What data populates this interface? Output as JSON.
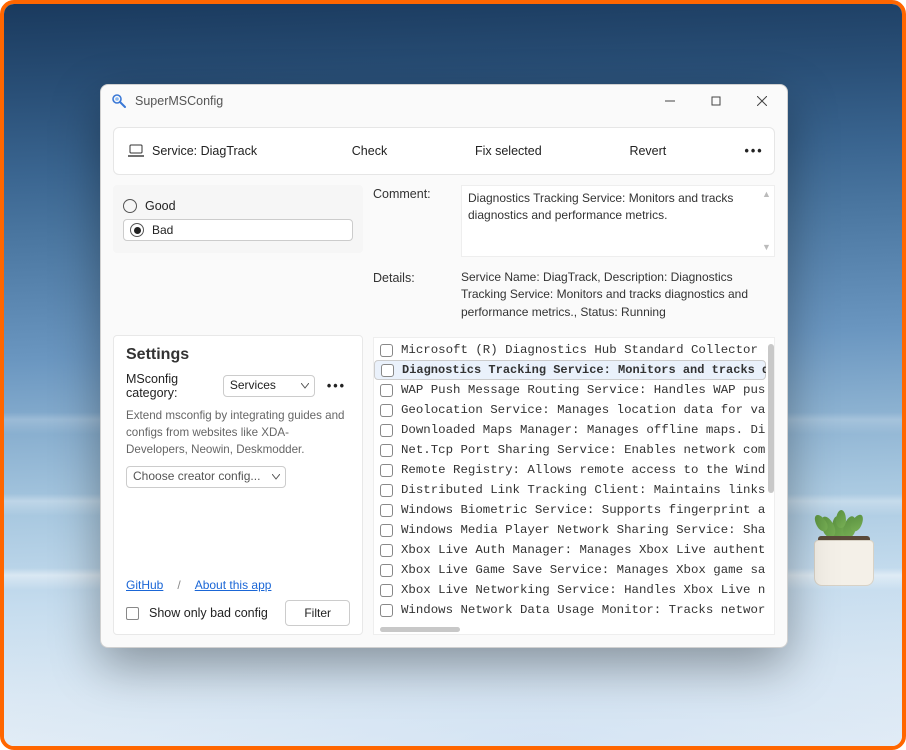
{
  "window": {
    "title": "SuperMSConfig"
  },
  "toolbar": {
    "service_label": "Service: DiagTrack",
    "check": "Check",
    "fix": "Fix selected",
    "revert": "Revert",
    "more": "•••"
  },
  "radios": {
    "good": "Good",
    "bad": "Bad",
    "selected": "bad"
  },
  "comment": {
    "label": "Comment:",
    "text": "Diagnostics Tracking Service: Monitors and tracks diagnostics and performance metrics."
  },
  "details": {
    "label": "Details:",
    "text": "Service Name: DiagTrack, Description: Diagnostics Tracking Service: Monitors and tracks diagnostics and performance metrics., Status: Running"
  },
  "settings": {
    "heading": "Settings",
    "category_label": "MSconfig category:",
    "category_value": "Services",
    "more": "•••",
    "hint": "Extend msconfig by integrating guides and configs from websites like XDA-Developers, Neowin, Deskmodder.",
    "creator_placeholder": "Choose creator config...",
    "links": {
      "github": "GitHub",
      "sep": "/",
      "about": "About this app"
    },
    "show_bad_label": "Show only bad config",
    "filter_btn": "Filter"
  },
  "list": {
    "selected_index": 1,
    "items": [
      {
        "text": "Microsoft (R) Diagnostics Hub Standard Collector Se",
        "bold": false
      },
      {
        "text": "Diagnostics Tracking Service: Monitors and tracks d",
        "bold": true
      },
      {
        "text": "WAP Push Message Routing Service: Handles WAP push ",
        "bold": false
      },
      {
        "text": "Geolocation Service: Manages location data for vari",
        "bold": false
      },
      {
        "text": "Downloaded Maps Manager: Manages offline maps. Disa",
        "bold": false
      },
      {
        "text": "Net.Tcp Port Sharing Service: Enables network commu",
        "bold": false
      },
      {
        "text": "Remote Registry: Allows remote access to the Window",
        "bold": false
      },
      {
        "text": "Distributed Link Tracking Client: Maintains links t",
        "bold": false
      },
      {
        "text": "Windows Biometric Service: Supports fingerprint and",
        "bold": false
      },
      {
        "text": "Windows Media Player Network Sharing Service: Share",
        "bold": false
      },
      {
        "text": "Xbox Live Auth Manager: Manages Xbox Live authentic",
        "bold": false
      },
      {
        "text": "Xbox Live Game Save Service: Manages Xbox game save",
        "bold": false
      },
      {
        "text": "Xbox Live Networking Service: Handles Xbox Live net",
        "bold": false
      },
      {
        "text": "Windows Network Data Usage Monitor: Tracks network ",
        "bold": false
      }
    ]
  }
}
